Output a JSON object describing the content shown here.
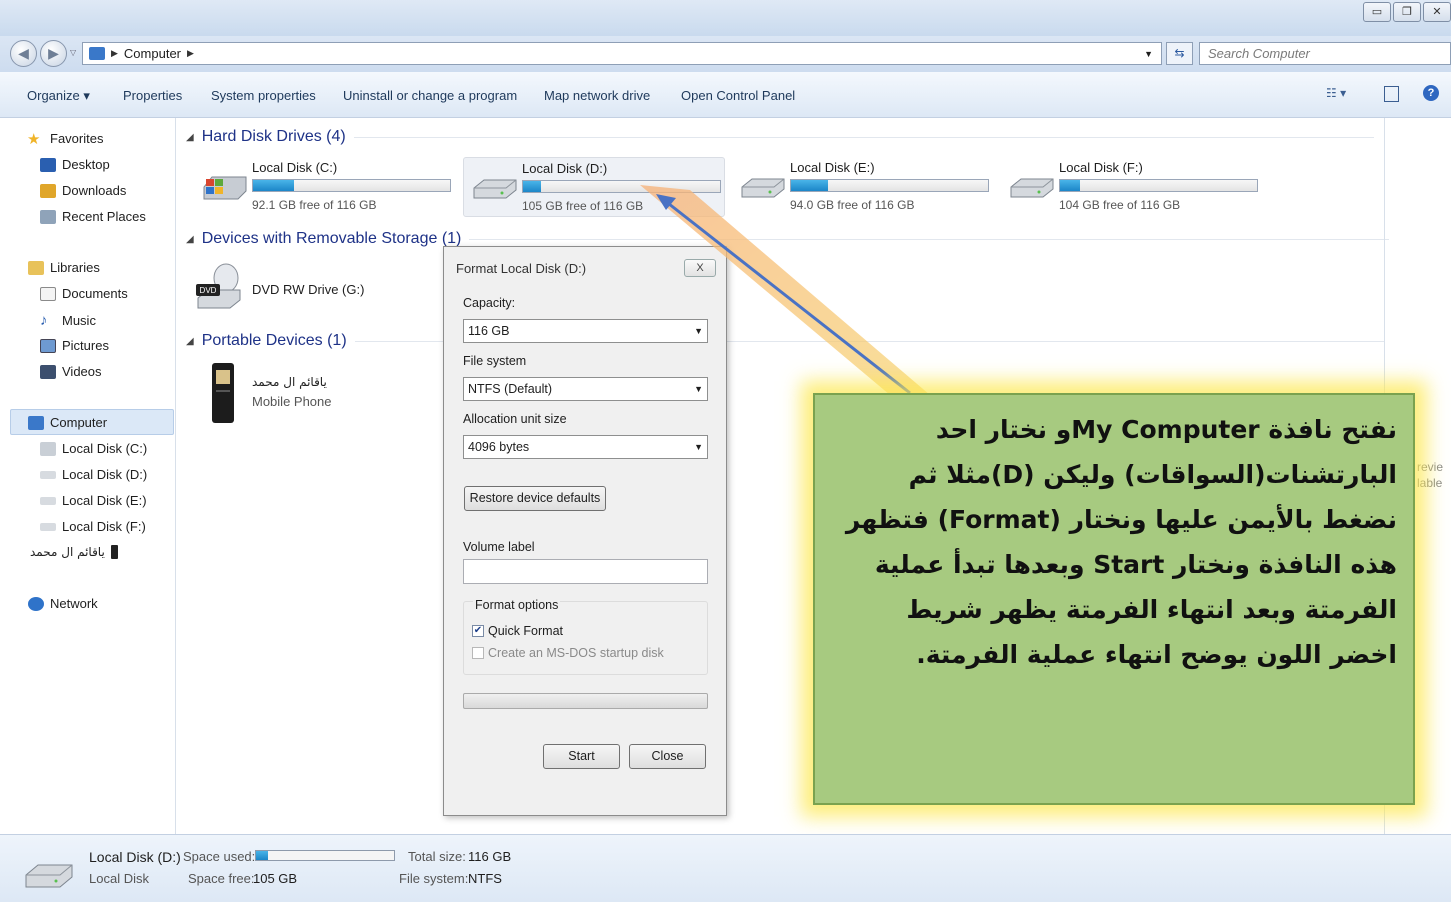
{
  "window": {
    "controls": [
      "minimize",
      "restore",
      "close"
    ]
  },
  "address_bar": {
    "location_item": "Computer",
    "search_placeholder": "Search Computer"
  },
  "toolbar": {
    "organize": "Organize ▾",
    "properties": "Properties",
    "system_properties": "System properties",
    "uninstall": "Uninstall or change a program",
    "map_network": "Map network drive",
    "open_control_panel": "Open Control Panel"
  },
  "nav": {
    "favorites": "Favorites",
    "desktop": "Desktop",
    "downloads": "Downloads",
    "recent_places": "Recent Places",
    "libraries": "Libraries",
    "documents": "Documents",
    "music": "Music",
    "pictures": "Pictures",
    "videos": "Videos",
    "computer": "Computer",
    "local_c": "Local Disk (C:)",
    "local_d": "Local Disk (D:)",
    "local_e": "Local Disk (E:)",
    "local_f": "Local Disk (F:)",
    "phone": "ياقائم ال محمد",
    "network": "Network"
  },
  "groups": {
    "hard_disks": "Hard Disk Drives (4)",
    "removable": "Devices with Removable Storage (1)",
    "portable": "Portable Devices (1)"
  },
  "drives": [
    {
      "name": "Local Disk (C:)",
      "free": "92.1 GB free of 116 GB",
      "used_fraction": 0.21
    },
    {
      "name": "Local Disk (D:)",
      "free": "105 GB free of 116 GB",
      "used_fraction": 0.09
    },
    {
      "name": "Local Disk (E:)",
      "free": "94.0 GB free of 116 GB",
      "used_fraction": 0.19
    },
    {
      "name": "Local Disk (F:)",
      "free": "104 GB free of 116 GB",
      "used_fraction": 0.1
    }
  ],
  "dvd": {
    "name": "DVD RW Drive (G:)",
    "badge": "DVD"
  },
  "phone_device": {
    "name": "ياقائم ال محمد",
    "type": "Mobile Phone"
  },
  "side_text": {
    "line1": "revie",
    "line2": "lable"
  },
  "dialog": {
    "title": "Format Local Disk (D:)",
    "close": "X",
    "capacity_label": "Capacity:",
    "capacity_value": "116 GB",
    "filesystem_label": "File system",
    "filesystem_value": "NTFS (Default)",
    "allocation_label": "Allocation unit size",
    "allocation_value": "4096 bytes",
    "restore_button": "Restore device defaults",
    "volume_label": "Volume label",
    "volume_value": "",
    "format_options": "Format options",
    "quick_format": "Quick Format",
    "quick_format_checked": true,
    "msdos": "Create an MS-DOS startup disk",
    "msdos_checked": false,
    "progress": 0,
    "start": "Start",
    "close_button": "Close"
  },
  "annotation": {
    "text": "نفتح نافذة My Computerو نختار احد البارتشنات(السواقات) وليكن (D)مثلا ثم نضغط بالأيمن عليها ونختار (Format) فتظهر هذه النافذة ونختار Start وبعدها تبدأ عملية الفرمتة وبعد انتهاء الفرمتة يظهر شريط اخضر اللون يوضح انتهاء عملية الفرمتة."
  },
  "details": {
    "name": "Local Disk (D:)",
    "type": "Local Disk",
    "space_used_label": "Space used:",
    "space_used_fraction": 0.09,
    "total_size_label": "Total size:",
    "total_size": "116 GB",
    "space_free_label": "Space free:",
    "space_free": "105 GB",
    "file_system_label": "File system:",
    "file_system": "NTFS"
  },
  "colors": {
    "group_header": "#1e3287",
    "usage_bar": "#1c86c8",
    "callout_fill": "#a7ca80",
    "callout_glow": "#fce850",
    "arrow": "#4a72c4"
  }
}
